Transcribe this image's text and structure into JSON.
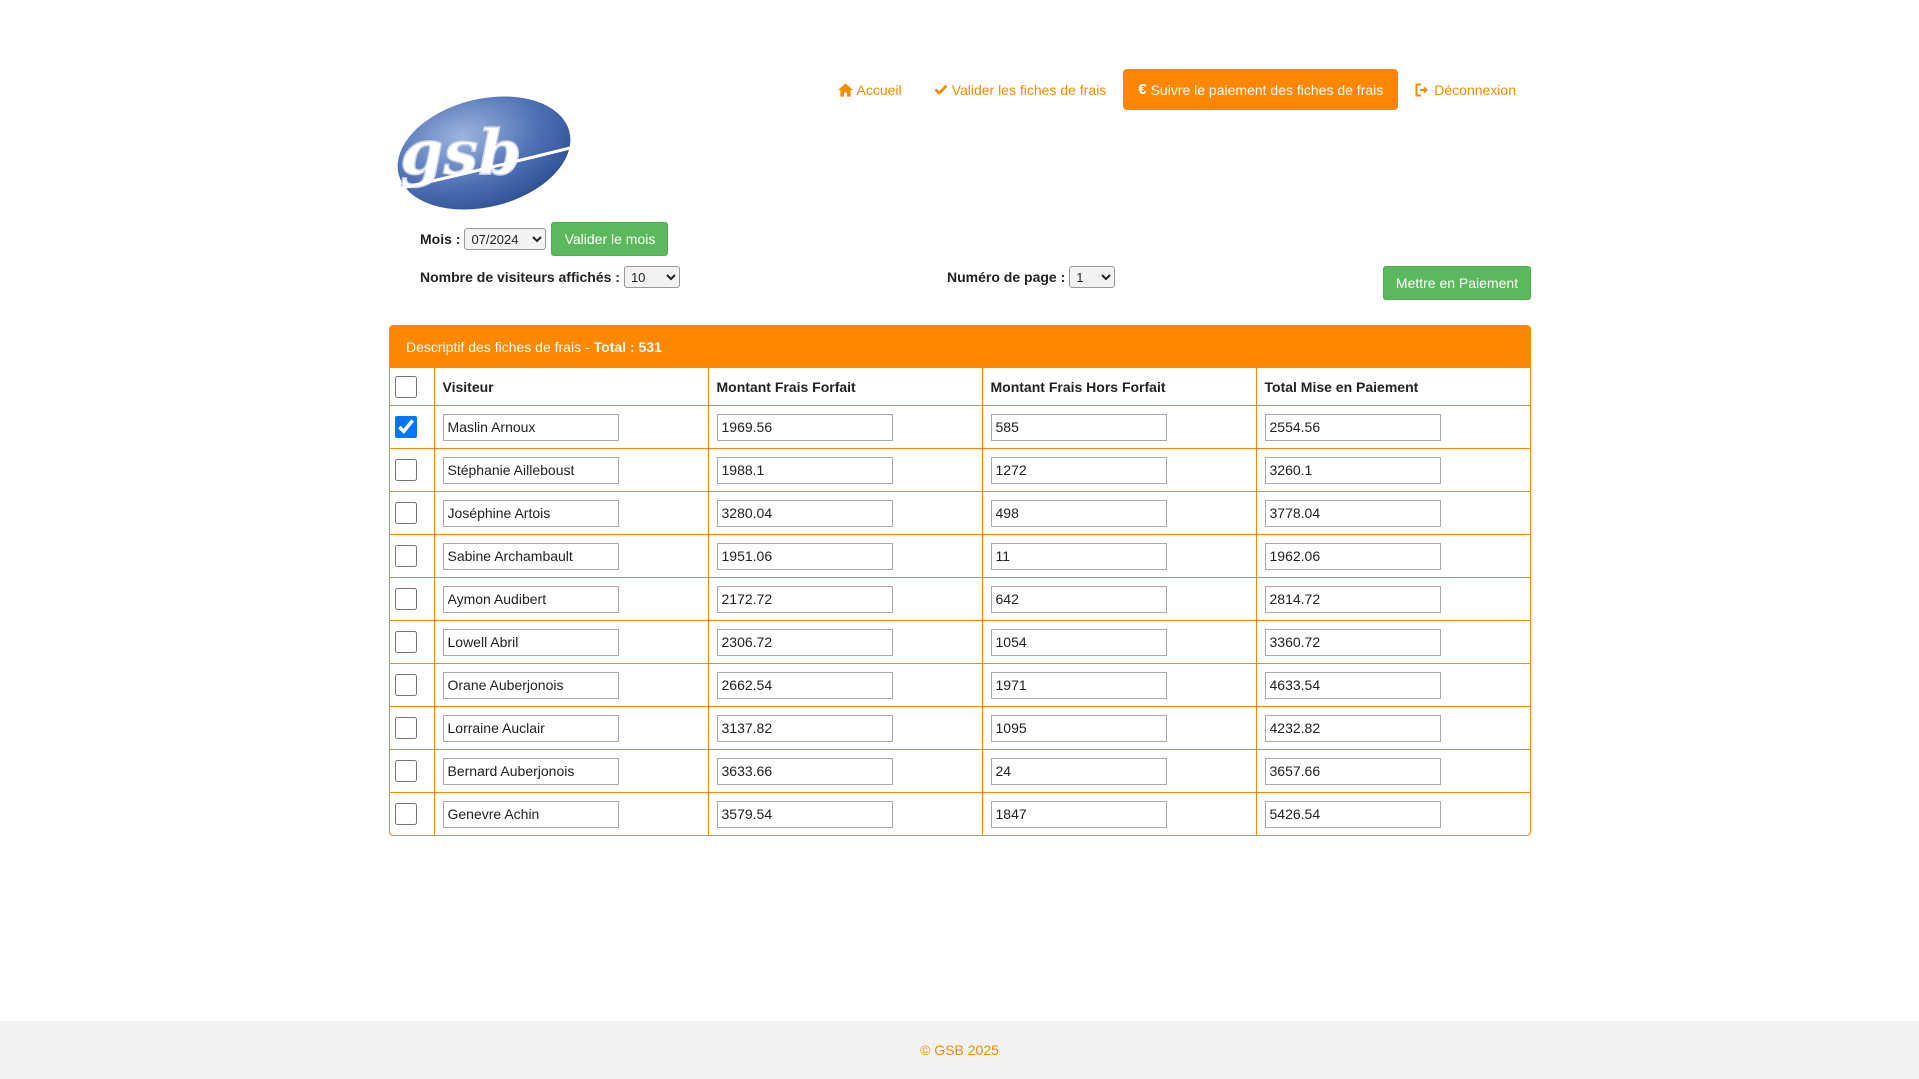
{
  "nav": {
    "items": [
      {
        "label": "Accueil",
        "icon": "home-icon"
      },
      {
        "label": "Valider les fiches de frais",
        "icon": "check-icon"
      },
      {
        "label": "Suivre le paiement des fiches de frais",
        "icon": "euro-icon"
      },
      {
        "label": "Déconnexion",
        "icon": "logout-icon"
      }
    ]
  },
  "logo": {
    "text": "gsb"
  },
  "filters": {
    "mois_label": "Mois :",
    "mois_value": "07/2024",
    "valider_mois_label": "Valider le mois",
    "nb_visiteurs_label": "Nombre de visiteurs affichés :",
    "nb_visiteurs_value": "10",
    "page_label": "Numéro de page :",
    "page_value": "1",
    "mettre_paiement_label": "Mettre en Paiement"
  },
  "panel": {
    "title": "Descriptif des fiches de frais -",
    "total": "Total : 531"
  },
  "table": {
    "headers": [
      "Visiteur",
      "Montant Frais Forfait",
      "Montant Frais Hors Forfait",
      "Total Mise en Paiement"
    ],
    "rows": [
      {
        "checked": true,
        "visiteur": "Maslin Arnoux",
        "forfait": "1969.56",
        "hors_forfait": "585",
        "total": "2554.56"
      },
      {
        "checked": false,
        "visiteur": "Stéphanie Ailleboust",
        "forfait": "1988.1",
        "hors_forfait": "1272",
        "total": "3260.1"
      },
      {
        "checked": false,
        "visiteur": "Joséphine Artois",
        "forfait": "3280.04",
        "hors_forfait": "498",
        "total": "3778.04"
      },
      {
        "checked": false,
        "visiteur": "Sabine Archambault",
        "forfait": "1951.06",
        "hors_forfait": "11",
        "total": "1962.06"
      },
      {
        "checked": false,
        "visiteur": "Aymon Audibert",
        "forfait": "2172.72",
        "hors_forfait": "642",
        "total": "2814.72"
      },
      {
        "checked": false,
        "visiteur": "Lowell Abril",
        "forfait": "2306.72",
        "hors_forfait": "1054",
        "total": "3360.72"
      },
      {
        "checked": false,
        "visiteur": "Orane Auberjonois",
        "forfait": "2662.54",
        "hors_forfait": "1971",
        "total": "4633.54"
      },
      {
        "checked": false,
        "visiteur": "Lorraine Auclair",
        "forfait": "3137.82",
        "hors_forfait": "1095",
        "total": "4232.82"
      },
      {
        "checked": false,
        "visiteur": "Bernard Auberjonois",
        "forfait": "3633.66",
        "hors_forfait": "24",
        "total": "3657.66"
      },
      {
        "checked": false,
        "visiteur": "Genevre Achin",
        "forfait": "3579.54",
        "hors_forfait": "1847",
        "total": "5426.54"
      }
    ]
  },
  "footer": {
    "text": "© GSB 2025"
  },
  "colors": {
    "accent": "#ff8800",
    "green": "#5cb85c",
    "checkbox": "#0b63d6"
  }
}
